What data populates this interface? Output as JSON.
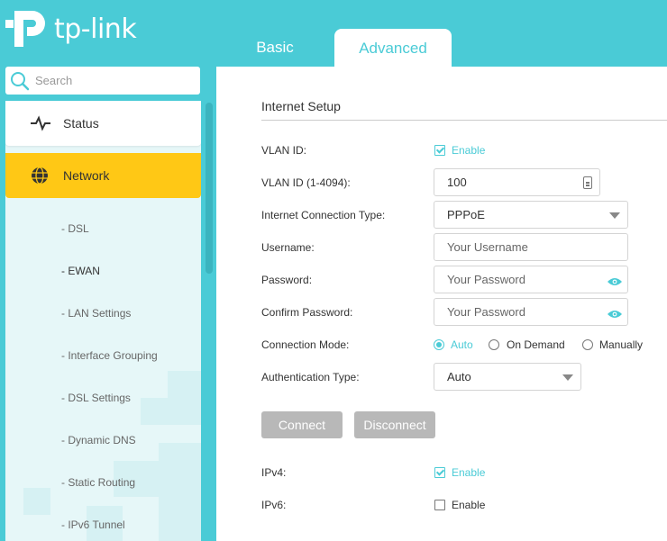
{
  "brand": {
    "name": "tp-link",
    "color": "#4acbd6"
  },
  "tabs": [
    {
      "label": "Basic",
      "active": false
    },
    {
      "label": "Advanced",
      "active": true
    }
  ],
  "sidebar": {
    "search": {
      "placeholder": "Search"
    },
    "items": [
      {
        "label": "Status",
        "icon": "pulse-icon"
      },
      {
        "label": "Network",
        "icon": "globe-icon",
        "active": true
      }
    ],
    "subitems": [
      {
        "label": "- DSL"
      },
      {
        "label": "- EWAN",
        "active": true
      },
      {
        "label": "- LAN Settings"
      },
      {
        "label": "- Interface Grouping"
      },
      {
        "label": "- DSL Settings"
      },
      {
        "label": "- Dynamic DNS"
      },
      {
        "label": "- Static Routing"
      },
      {
        "label": "- IPv6 Tunnel"
      }
    ]
  },
  "form": {
    "title": "Internet Setup",
    "vlan": {
      "label": "VLAN ID:",
      "enable_label": "Enable",
      "checked": true
    },
    "vlan_id": {
      "label": "VLAN ID (1-4094):",
      "value": "100"
    },
    "connection_type": {
      "label": "Internet Connection Type:",
      "value": "PPPoE"
    },
    "username": {
      "label": "Username:",
      "placeholder": "Your Username"
    },
    "password": {
      "label": "Password:",
      "placeholder": "Your Password"
    },
    "confirm_password": {
      "label": "Confirm Password:",
      "placeholder": "Your Password"
    },
    "connection_mode": {
      "label": "Connection Mode:",
      "options": [
        "Auto",
        "On Demand",
        "Manually"
      ],
      "selected": "Auto"
    },
    "auth_type": {
      "label": "Authentication Type:",
      "value": "Auto"
    },
    "buttons": {
      "connect": "Connect",
      "disconnect": "Disconnect"
    },
    "ipv4": {
      "label": "IPv4:",
      "enable_label": "Enable",
      "checked": true
    },
    "ipv6": {
      "label": "IPv6:",
      "enable_label": "Enable",
      "checked": false
    }
  }
}
